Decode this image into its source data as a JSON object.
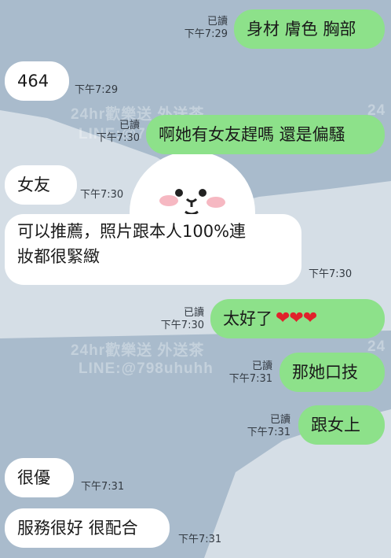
{
  "watermark": {
    "line1": "24hr歡樂送 外送茶",
    "line2": "LINE:@798uhuhh",
    "short": "24"
  },
  "messages": [
    {
      "side": "out",
      "text": "身材 膚色 胸部",
      "read": "已讀",
      "time": "下午7:29"
    },
    {
      "side": "in",
      "text": "464",
      "time": "下午7:29"
    },
    {
      "side": "out",
      "text": "啊她有女友趕嗎 還是偏騷",
      "read": "已讀",
      "time": "下午7:30"
    },
    {
      "side": "in",
      "text": "女友",
      "time": "下午7:30"
    },
    {
      "side": "in",
      "line1": "可以推薦，照片跟本人100%連",
      "line2": "妝都很緊緻",
      "time": "下午7:30"
    },
    {
      "side": "out",
      "text": "太好了",
      "hearts": "❤❤❤",
      "read": "已讀",
      "time": "下午7:30"
    },
    {
      "side": "out",
      "text": "那她口技",
      "read": "已讀",
      "time": "下午7:31"
    },
    {
      "side": "out",
      "text": "跟女上",
      "read": "已讀",
      "time": "下午7:31"
    },
    {
      "side": "in",
      "text": "很優",
      "time": "下午7:31"
    },
    {
      "side": "in",
      "text": "服務很好 很配合",
      "time": "下午7:31"
    }
  ],
  "colors": {
    "background": "#a9bbcc",
    "outgoing_bubble": "#8de18a",
    "incoming_bubble": "#ffffff",
    "heart": "#e0222b"
  }
}
